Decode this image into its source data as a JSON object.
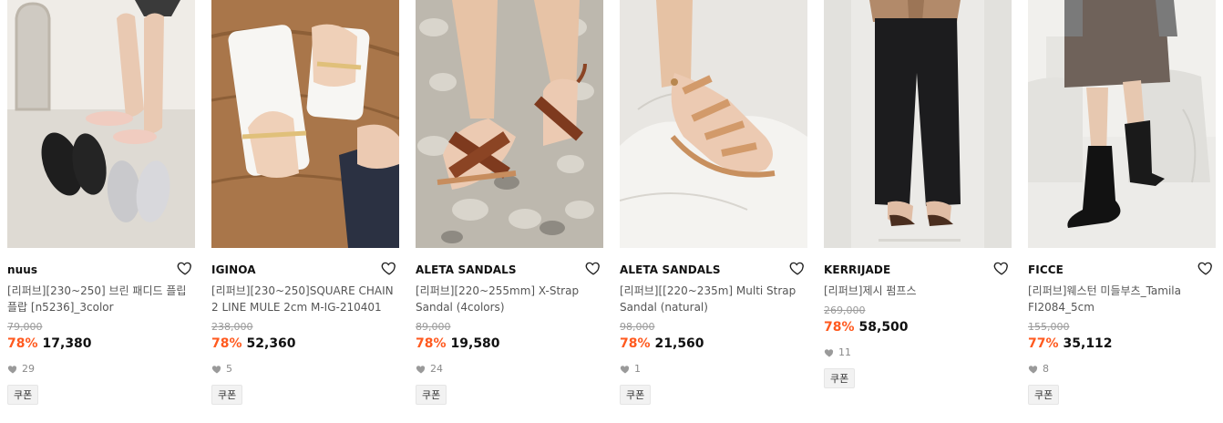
{
  "products": [
    {
      "brand": "nuus",
      "title": "[리퍼브][230~250] 브린 패디드 플립플랍 [n5236]_3color",
      "original_price": "79,000",
      "discount": "78%",
      "sale_price": "17,380",
      "likes": "29",
      "coupon": "쿠폰"
    },
    {
      "brand": "IGINOA",
      "title": "[리퍼브][230~250]SQUARE CHAIN 2 LINE MULE 2cm M-IG-210401",
      "original_price": "238,000",
      "discount": "78%",
      "sale_price": "52,360",
      "likes": "5",
      "coupon": "쿠폰"
    },
    {
      "brand": "ALETA SANDALS",
      "title": "[리퍼브][220~255mm] X-Strap Sandal (4colors)",
      "original_price": "89,000",
      "discount": "78%",
      "sale_price": "19,580",
      "likes": "24",
      "coupon": "쿠폰"
    },
    {
      "brand": "ALETA SANDALS",
      "title": "[리퍼브][[220~235m] Multi Strap Sandal (natural)",
      "original_price": "98,000",
      "discount": "78%",
      "sale_price": "21,560",
      "likes": "1",
      "coupon": "쿠폰"
    },
    {
      "brand": "KERRIJADE",
      "title": "[리퍼브]제시 펌프스",
      "original_price": "269,000",
      "discount": "78%",
      "sale_price": "58,500",
      "likes": "11",
      "coupon": "쿠폰"
    },
    {
      "brand": "FICCE",
      "title": "[리퍼브]웨스턴 미들부츠_Tamila FI2084_5cm",
      "original_price": "155,000",
      "discount": "77%",
      "sale_price": "35,112",
      "likes": "8",
      "coupon": "쿠폰"
    }
  ],
  "colors": {
    "discount": "#ff5a1f",
    "strikethrough_price": "#9a9a9a",
    "meta_text": "#8a8a8a"
  },
  "icons": {
    "wishlist": "heart-outline-icon",
    "likes": "heart-filled-icon"
  }
}
